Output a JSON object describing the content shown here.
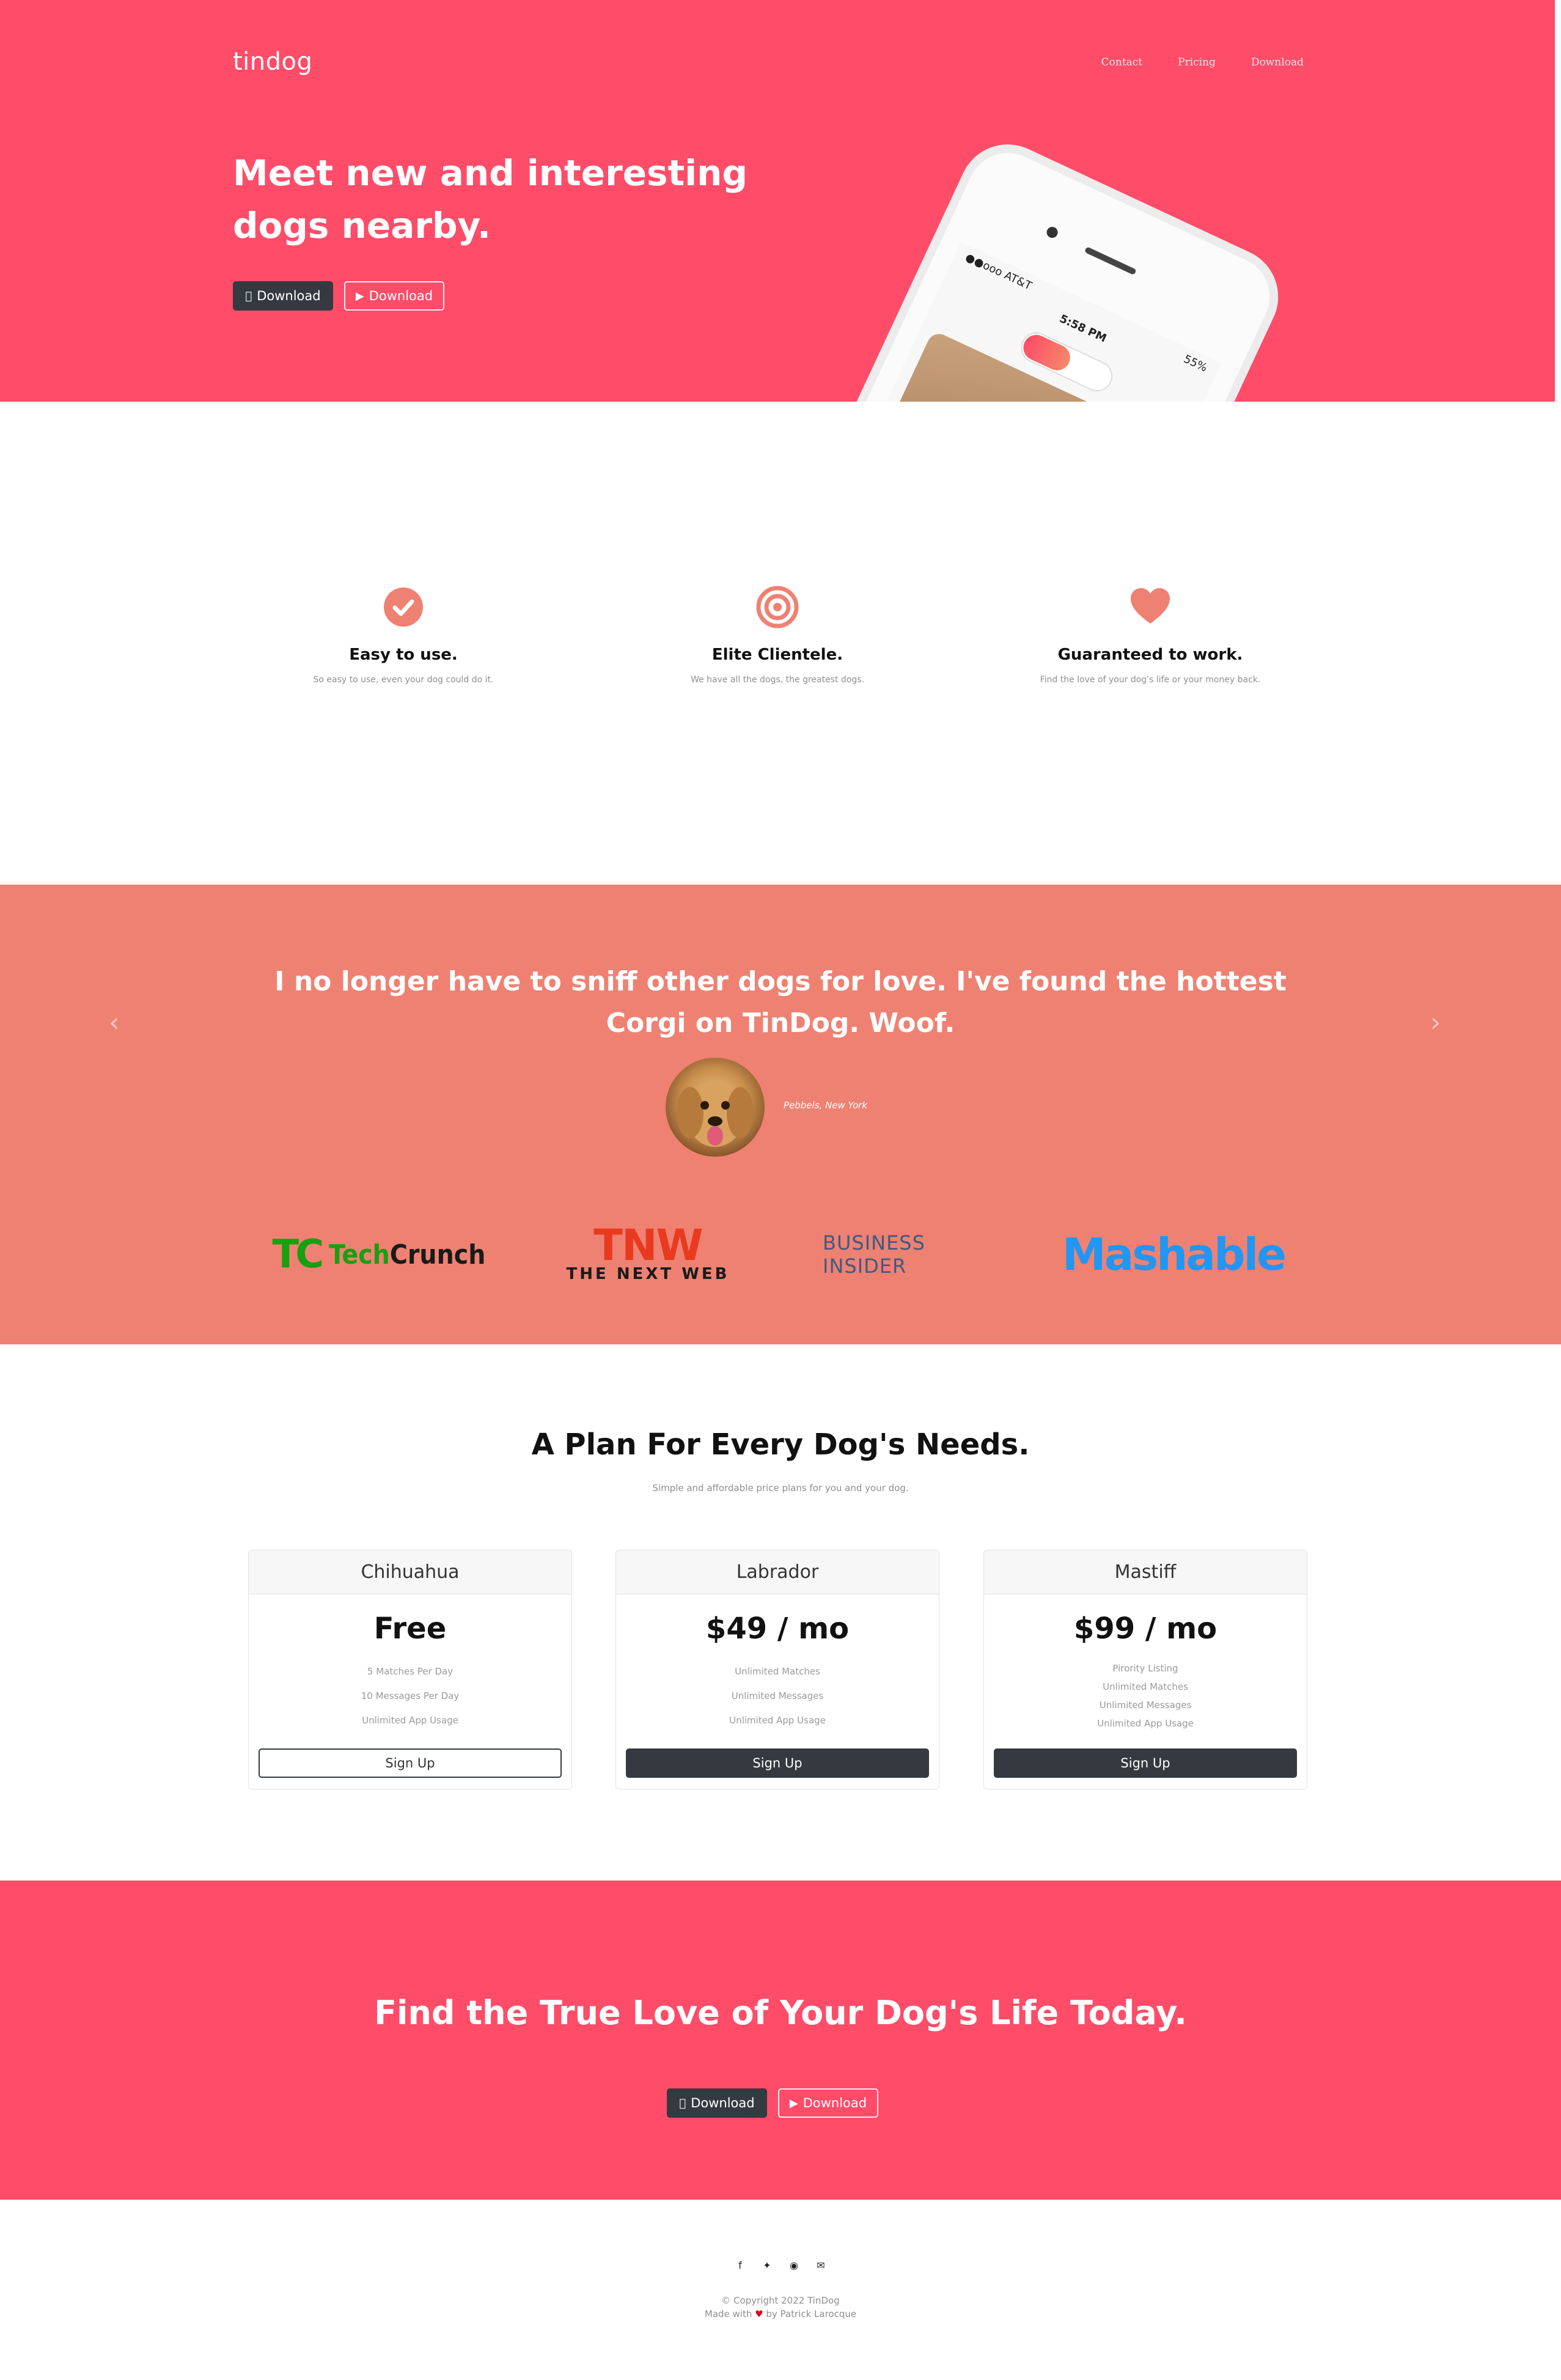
{
  "hero": {
    "brand": "tindog",
    "nav": [
      "Contact",
      "Pricing",
      "Download"
    ],
    "title_line1": "Meet new and interesting",
    "title_line2": "dogs nearby.",
    "download_apple": "Download",
    "download_google": "Download",
    "phone": {
      "carrier": "●●ooo AT&T",
      "time": "5:58 PM",
      "battery": "55%"
    }
  },
  "features": [
    {
      "icon": "check-circle-icon",
      "title": "Easy to use.",
      "text": "So easy to use, even your dog could do it."
    },
    {
      "icon": "bullseye-icon",
      "title": "Elite Clientele.",
      "text": "We have all the dogs, the greatest dogs."
    },
    {
      "icon": "heart-icon",
      "title": "Guaranteed to work.",
      "text": "Find the love of your dog's life or your money back."
    }
  ],
  "testimonial": {
    "quote_line1": "I no longer have to sniff other dogs for love. I've found the hottest",
    "quote_line2": "Corgi on TinDog. Woof.",
    "caption": "Pebbels, New York"
  },
  "press": {
    "techcrunch_mark": "TC",
    "techcrunch_a": "Tech",
    "techcrunch_b": "Crunch",
    "tnw_mark": "TNW",
    "tnw_sub": "THE NEXT WEB",
    "business_insider": "BUSINESS INSIDER",
    "mashable": "Mashable"
  },
  "pricing": {
    "title": "A Plan For Every Dog's Needs.",
    "subtitle": "Simple and affordable price plans for you and your dog.",
    "plans": [
      {
        "name": "Chihuahua",
        "price": "Free",
        "features": [
          "5 Matches Per Day",
          "10 Messages Per Day",
          "Unlimited App Usage"
        ],
        "button": "Sign Up"
      },
      {
        "name": "Labrador",
        "price": "$49 / mo",
        "features": [
          "Unlimited Matches",
          "Unlimited Messages",
          "Unlimited App Usage"
        ],
        "button": "Sign Up"
      },
      {
        "name": "Mastiff",
        "price": "$99 / mo",
        "features": [
          "Pirority Listing",
          "Unlimited Matches",
          "Unlimited Messages",
          "Unlimited App Usage"
        ],
        "button": "Sign Up"
      }
    ]
  },
  "cta": {
    "title": "Find the True Love of Your Dog's Life Today.",
    "download_apple": "Download",
    "download_google": "Download"
  },
  "footer": {
    "copyright": "© Copyright 2022 TinDog",
    "made_with": "Made with",
    "made_by": "by Patrick Larocque"
  },
  "colors": {
    "primary_red": "#ff4c68",
    "salmon": "#ef8172",
    "dark": "#343a40"
  }
}
